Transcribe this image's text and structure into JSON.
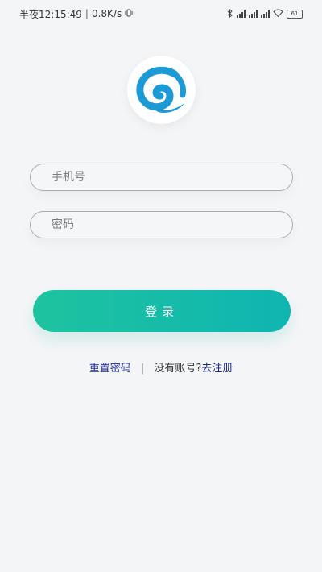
{
  "status_bar": {
    "time": "半夜12:15:49",
    "speed": "0.8K/s",
    "battery": "61"
  },
  "icons": {
    "vibrate": "vibrate-icon",
    "bluetooth": "bluetooth-icon",
    "signal": "signal-icon",
    "wifi": "wifi-icon",
    "battery": "battery-icon"
  },
  "login": {
    "phone_placeholder": "手机号",
    "password_placeholder": "密码",
    "login_label": "登录"
  },
  "links": {
    "reset_password": "重置密码",
    "separator": "|",
    "no_account": "没有账号?",
    "register": "去注册"
  },
  "colors": {
    "background": "#f4f5f7",
    "accent": "#14bca8",
    "link": "#1b2a8f",
    "logo_blue": "#1b9ad6"
  }
}
